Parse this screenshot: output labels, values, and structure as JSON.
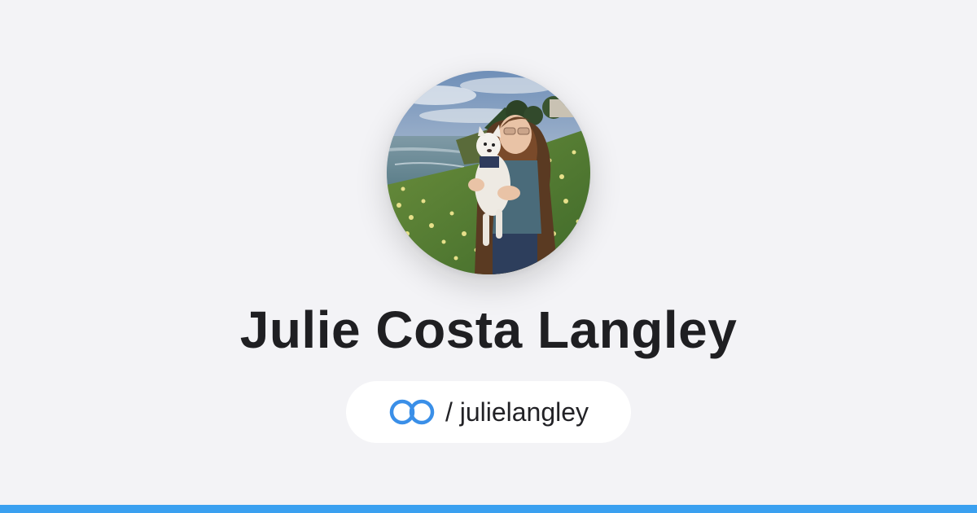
{
  "profile": {
    "name": "Julie Costa Langley",
    "handle": "/ julielangley",
    "avatar_icon": "profile-photo"
  },
  "brand": {
    "logo_icon": "linked-rings-icon",
    "accent_color": "#3a8fe8",
    "bar_color": "#3aa0f0"
  }
}
